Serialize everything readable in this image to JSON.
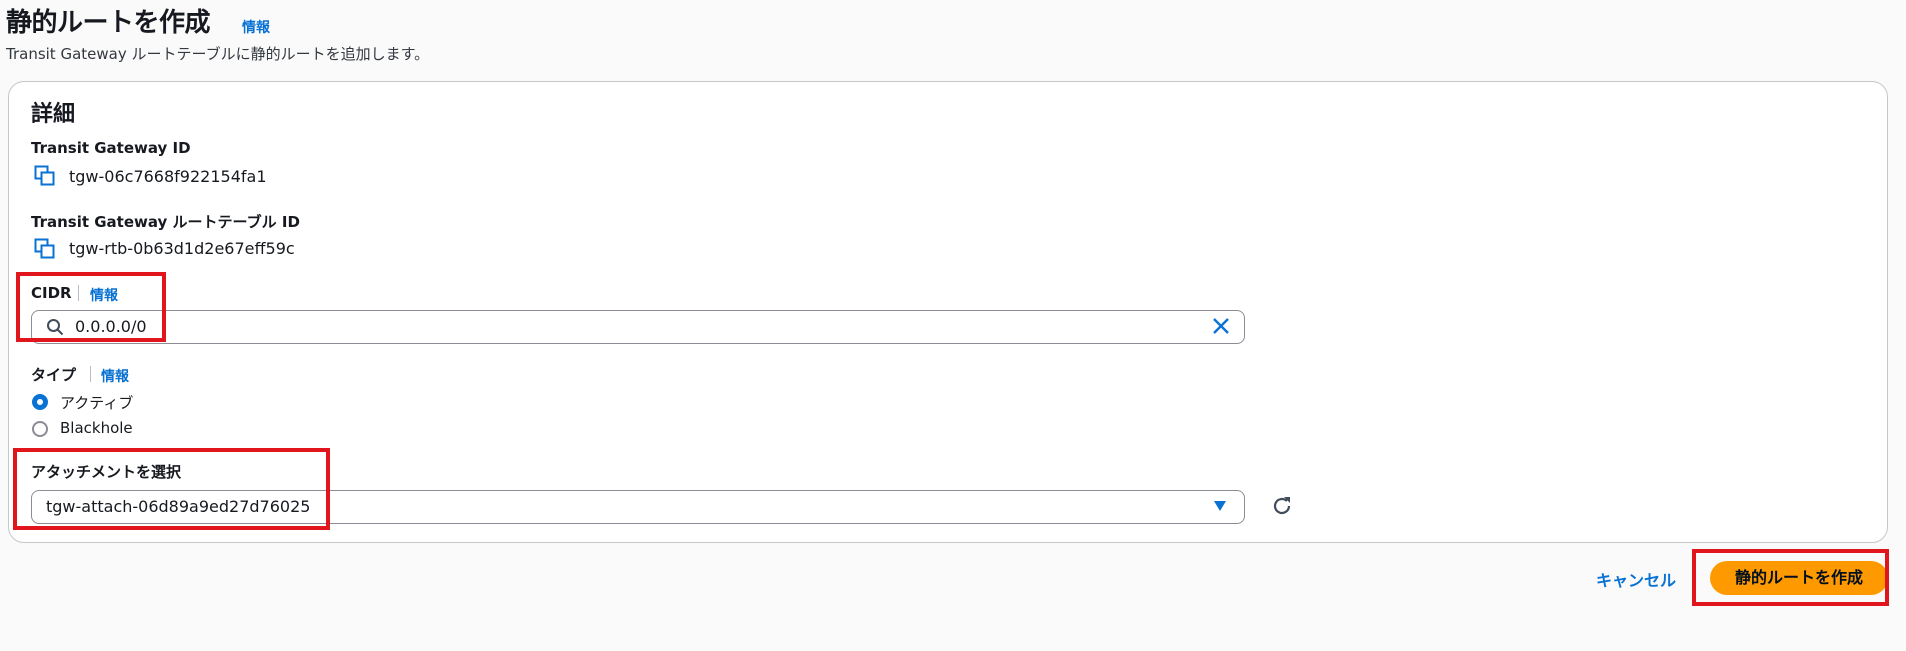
{
  "header": {
    "title": "静的ルートを作成",
    "info": "情報",
    "description": "Transit Gateway ルートテーブルに静的ルートを追加します。"
  },
  "panel": {
    "title": "詳細",
    "tgw_id": {
      "label": "Transit Gateway ID",
      "value": "tgw-06c7668f922154fa1"
    },
    "rtb_id": {
      "label": "Transit Gateway ルートテーブル ID",
      "value": "tgw-rtb-0b63d1d2e67eff59c"
    },
    "cidr": {
      "label": "CIDR",
      "info": "情報",
      "value": "0.0.0.0/0"
    },
    "type": {
      "label": "タイプ",
      "info": "情報",
      "options": [
        {
          "label": "アクティブ",
          "selected": true
        },
        {
          "label": "Blackhole",
          "selected": false
        }
      ]
    },
    "attachment": {
      "label": "アタッチメントを選択",
      "selected": "tgw-attach-06d89a9ed27d76025"
    }
  },
  "footer": {
    "cancel": "キャンセル",
    "submit": "静的ルートを作成"
  },
  "colors": {
    "accent": "#0972d3",
    "primary_button": "#ff9900",
    "highlight": "#e0161c"
  }
}
